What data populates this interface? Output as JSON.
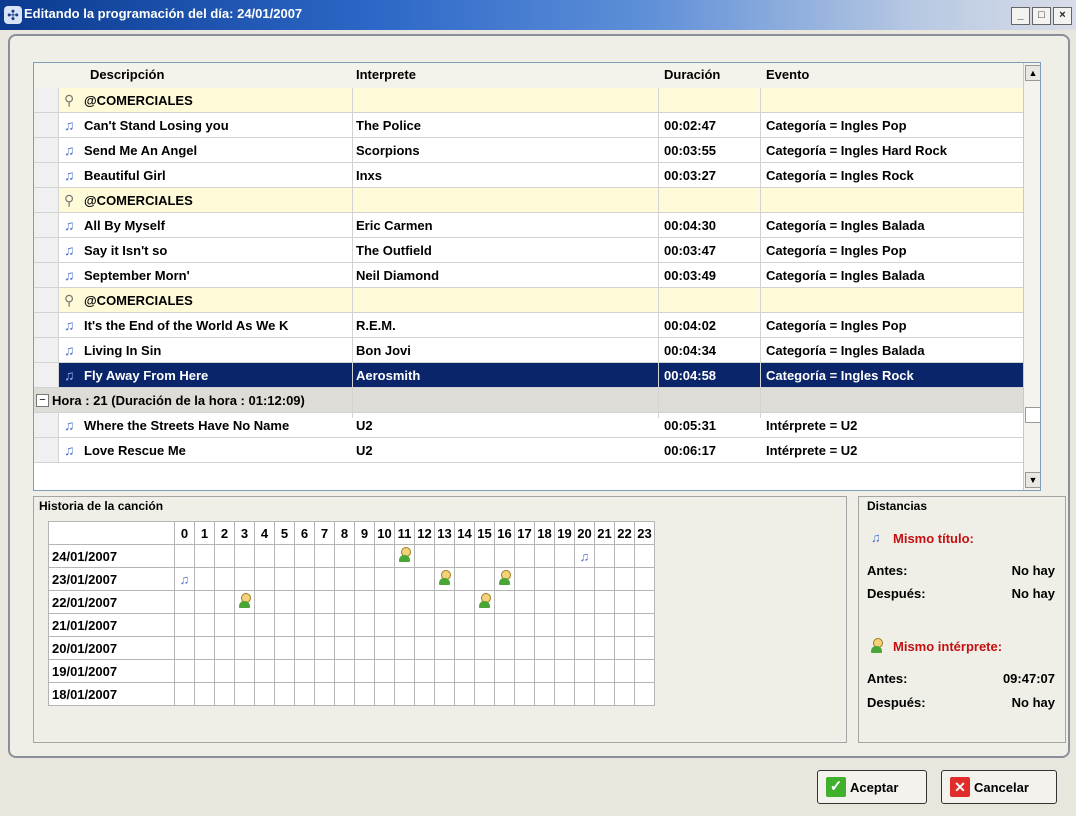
{
  "window": {
    "title": "Editando la programación del día: 24/01/2007"
  },
  "columns": [
    "Descripción",
    "Interprete",
    "Duración",
    "Evento"
  ],
  "rows": [
    {
      "type": "com",
      "desc": "@COMERCIALES",
      "artist": "",
      "dur": "",
      "event": ""
    },
    {
      "type": "song",
      "desc": "Can't Stand Losing you",
      "artist": "The Police",
      "dur": "00:02:47",
      "event": "Categoría = Ingles Pop"
    },
    {
      "type": "song",
      "desc": "Send Me An Angel",
      "artist": "Scorpions",
      "dur": "00:03:55",
      "event": "Categoría = Ingles Hard Rock"
    },
    {
      "type": "song",
      "desc": "Beautiful Girl",
      "artist": "Inxs",
      "dur": "00:03:27",
      "event": "Categoría = Ingles Rock"
    },
    {
      "type": "com",
      "desc": "@COMERCIALES",
      "artist": "",
      "dur": "",
      "event": ""
    },
    {
      "type": "song",
      "desc": "All By Myself",
      "artist": "Eric Carmen",
      "dur": "00:04:30",
      "event": "Categoría = Ingles Balada"
    },
    {
      "type": "song",
      "desc": "Say it Isn't so",
      "artist": "The Outfield",
      "dur": "00:03:47",
      "event": "Categoría = Ingles Pop"
    },
    {
      "type": "song",
      "desc": "September Morn'",
      "artist": "Neil Diamond",
      "dur": "00:03:49",
      "event": "Categoría = Ingles Balada"
    },
    {
      "type": "com",
      "desc": "@COMERCIALES",
      "artist": "",
      "dur": "",
      "event": ""
    },
    {
      "type": "song",
      "desc": "It's the End of the World As We K",
      "artist": "R.E.M.",
      "dur": "00:04:02",
      "event": "Categoría = Ingles Pop"
    },
    {
      "type": "song",
      "desc": "Living In Sin",
      "artist": "Bon Jovi",
      "dur": "00:04:34",
      "event": "Categoría = Ingles Balada"
    },
    {
      "type": "sel",
      "desc": "Fly Away From Here",
      "artist": "Aerosmith",
      "dur": "00:04:58",
      "event": "Categoría = Ingles Rock"
    },
    {
      "type": "group",
      "desc": "Hora : 21 (Duración de la hora : 01:12:09)",
      "artist": "",
      "dur": "",
      "event": ""
    },
    {
      "type": "song",
      "desc": "Where the Streets Have No Name",
      "artist": "U2",
      "dur": "00:05:31",
      "event": "Intérprete = U2"
    },
    {
      "type": "song",
      "desc": "Love Rescue Me",
      "artist": "U2",
      "dur": "00:06:17",
      "event": "Intérprete = U2"
    }
  ],
  "history": {
    "title": "Historia de la canción",
    "hours": [
      "0",
      "1",
      "2",
      "3",
      "4",
      "5",
      "6",
      "7",
      "8",
      "9",
      "10",
      "11",
      "12",
      "13",
      "14",
      "15",
      "16",
      "17",
      "18",
      "19",
      "20",
      "21",
      "22",
      "23"
    ],
    "dates": [
      "24/01/2007",
      "23/01/2007",
      "22/01/2007",
      "21/01/2007",
      "20/01/2007",
      "19/01/2007",
      "18/01/2007"
    ],
    "marks": [
      {
        "row": 0,
        "hour": 11,
        "kind": "person"
      },
      {
        "row": 0,
        "hour": 20,
        "kind": "note"
      },
      {
        "row": 1,
        "hour": 0,
        "kind": "note"
      },
      {
        "row": 1,
        "hour": 13,
        "kind": "person"
      },
      {
        "row": 1,
        "hour": 16,
        "kind": "person"
      },
      {
        "row": 2,
        "hour": 3,
        "kind": "person"
      },
      {
        "row": 2,
        "hour": 15,
        "kind": "person"
      }
    ]
  },
  "distancias": {
    "title": "Distancias",
    "mismo_titulo": "Mismo título:",
    "mismo_interprete": "Mismo intérprete:",
    "antes": "Antes:",
    "despues": "Después:",
    "titulo_antes": "No hay",
    "titulo_despues": "No hay",
    "interp_antes": "09:47:07",
    "interp_despues": "No hay"
  },
  "buttons": {
    "accept": "Aceptar",
    "cancel": "Cancelar"
  }
}
